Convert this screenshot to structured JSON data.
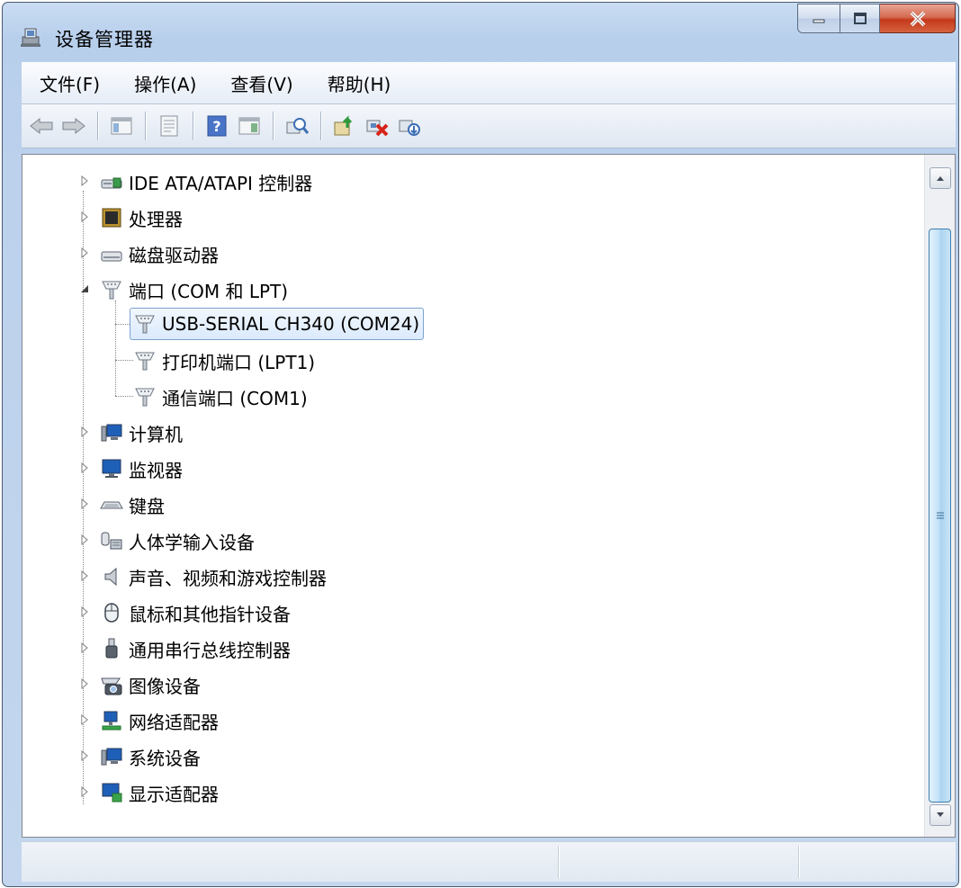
{
  "window": {
    "title": "设备管理器",
    "controls": {
      "minimize": "minimize",
      "maximize": "maximize",
      "close": "close"
    }
  },
  "menu": [
    {
      "label": "文件(F)"
    },
    {
      "label": "操作(A)"
    },
    {
      "label": "查看(V)"
    },
    {
      "label": "帮助(H)"
    }
  ],
  "toolbar": [
    {
      "icon": "back-arrow-icon"
    },
    {
      "icon": "forward-arrow-icon"
    },
    {
      "icon": "show-hide-console-tree-icon"
    },
    {
      "icon": "properties-icon"
    },
    {
      "icon": "help-icon"
    },
    {
      "icon": "show-hide-action-pane-icon"
    },
    {
      "icon": "scan-hardware-changes-icon"
    },
    {
      "icon": "update-driver-icon"
    },
    {
      "icon": "uninstall-device-icon"
    },
    {
      "icon": "disable-device-icon"
    }
  ],
  "tree": {
    "items": [
      {
        "label": "IDE ATA/ATAPI 控制器",
        "icon": "ide-controller-icon",
        "expanded": false
      },
      {
        "label": "处理器",
        "icon": "processor-icon",
        "expanded": false
      },
      {
        "label": "磁盘驱动器",
        "icon": "disk-drive-icon",
        "expanded": false
      },
      {
        "label": "端口 (COM 和 LPT)",
        "icon": "port-icon",
        "expanded": true,
        "children": [
          {
            "label": "USB-SERIAL CH340 (COM24)",
            "icon": "port-icon",
            "selected": true
          },
          {
            "label": "打印机端口 (LPT1)",
            "icon": "port-icon"
          },
          {
            "label": "通信端口 (COM1)",
            "icon": "port-icon"
          }
        ]
      },
      {
        "label": "计算机",
        "icon": "computer-icon",
        "expanded": false
      },
      {
        "label": "监视器",
        "icon": "monitor-icon",
        "expanded": false
      },
      {
        "label": "键盘",
        "icon": "keyboard-icon",
        "expanded": false
      },
      {
        "label": "人体学输入设备",
        "icon": "hid-icon",
        "expanded": false
      },
      {
        "label": "声音、视频和游戏控制器",
        "icon": "speaker-icon",
        "expanded": false
      },
      {
        "label": "鼠标和其他指针设备",
        "icon": "mouse-icon",
        "expanded": false
      },
      {
        "label": "通用串行总线控制器",
        "icon": "usb-icon",
        "expanded": false
      },
      {
        "label": "图像设备",
        "icon": "camera-icon",
        "expanded": false
      },
      {
        "label": "网络适配器",
        "icon": "network-adapter-icon",
        "expanded": false
      },
      {
        "label": "系统设备",
        "icon": "system-device-icon",
        "expanded": false
      },
      {
        "label": "显示适配器",
        "icon": "display-adapter-icon",
        "expanded": false
      }
    ]
  },
  "statusbar": {
    "panes": [
      "",
      "",
      ""
    ]
  }
}
